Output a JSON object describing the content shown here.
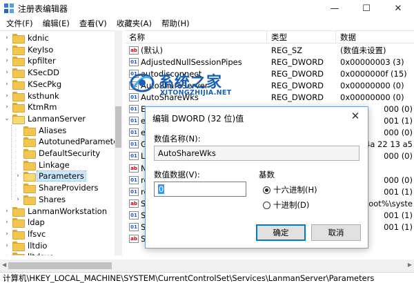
{
  "window": {
    "title": "注册表编辑器",
    "minimize": "—",
    "maximize": "☐",
    "close": "✕"
  },
  "menu": [
    "文件(F)",
    "编辑(E)",
    "查看(V)",
    "收藏夹(A)",
    "帮助(H)"
  ],
  "tree": {
    "items": [
      {
        "label": "kdnic",
        "expandable": true
      },
      {
        "label": "KeyIso",
        "expandable": true
      },
      {
        "label": "kpfilter",
        "expandable": true
      },
      {
        "label": "KSecDD",
        "expandable": true
      },
      {
        "label": "KSecPkg",
        "expandable": true
      },
      {
        "label": "ksthunk",
        "expandable": true
      },
      {
        "label": "KtmRm",
        "expandable": true
      },
      {
        "label": "LanmanServer",
        "expandable": true,
        "expanded": true
      },
      {
        "label": "Aliases",
        "child": true
      },
      {
        "label": "AutotunedParameters",
        "child": true
      },
      {
        "label": "DefaultSecurity",
        "child": true
      },
      {
        "label": "Linkage",
        "child": true
      },
      {
        "label": "Parameters",
        "child": true,
        "selected": true,
        "expandable": true
      },
      {
        "label": "ShareProviders",
        "child": true
      },
      {
        "label": "Shares",
        "child": true,
        "expandable": true
      },
      {
        "label": "LanmanWorkstation",
        "expandable": true
      },
      {
        "label": "ldap",
        "expandable": true
      },
      {
        "label": "lfsvc",
        "expandable": true
      },
      {
        "label": "lltdio",
        "expandable": true
      },
      {
        "label": "lltdsvc",
        "expandable": true
      }
    ]
  },
  "list": {
    "headers": [
      "名称",
      "类型",
      "数据"
    ],
    "rows": [
      {
        "icon": "ab",
        "name": "(默认)",
        "type": "REG_SZ",
        "data": "(数值未设置)"
      },
      {
        "icon": "bin",
        "name": "AdjustedNullSessionPipes",
        "type": "REG_DWORD",
        "data": "0x00000003 (3)"
      },
      {
        "icon": "bin",
        "name": "autodisconnect",
        "type": "REG_DWORD",
        "data": "0x0000000f (15)"
      },
      {
        "icon": "bin",
        "name": "AutoShareServer",
        "type": "REG_DWORD",
        "data": "0x00000000 (0)"
      },
      {
        "icon": "bin",
        "name": "AutoShareWks",
        "type": "REG_DWORD",
        "data": "0x00000000 (0)"
      },
      {
        "icon": "bin",
        "name": "En",
        "type": "",
        "data": "000 (0)"
      },
      {
        "icon": "bin",
        "name": "en",
        "type": "",
        "data": "001 (1)"
      },
      {
        "icon": "bin",
        "name": "en",
        "type": "",
        "data": "000 (0)"
      },
      {
        "icon": "bin",
        "name": "Gu",
        "type": "",
        "data": "4a 22 13 a5"
      },
      {
        "icon": "bin",
        "name": "Ln",
        "type": "",
        "data": "000 (0)"
      },
      {
        "icon": "ab",
        "name": "N",
        "type": "",
        "data": ""
      },
      {
        "icon": "bin",
        "name": "re",
        "type": "",
        "data": "000 (0)"
      },
      {
        "icon": "bin",
        "name": "re",
        "type": "",
        "data": "001 (1)"
      },
      {
        "icon": "ab",
        "name": "Se",
        "type": "",
        "data": "mRoot%\\syste"
      },
      {
        "icon": "bin",
        "name": "Se",
        "type": "",
        "data": "001 (1)"
      },
      {
        "icon": "bin",
        "name": "Si",
        "type": "",
        "data": "001 (1)"
      },
      {
        "icon": "ab",
        "name": "Sr",
        "type": "",
        "data": ""
      }
    ]
  },
  "watermark": {
    "text": "系统之家",
    "sub": "XITONGZHIJIA.NET"
  },
  "dialog": {
    "title": "编辑 DWORD (32 位)值",
    "close": "✕",
    "name_label": "数值名称(N):",
    "name_value": "AutoShareWks",
    "data_label": "数值数据(V):",
    "data_value": "0",
    "base_label": "基数",
    "hex_label": "十六进制(H)",
    "dec_label": "十进制(D)",
    "ok": "确定",
    "cancel": "取消"
  },
  "status": "计算机\\HKEY_LOCAL_MACHINE\\SYSTEM\\CurrentControlSet\\Services\\LanmanServer\\Parameters",
  "colors": {
    "selection": "#cce8ff",
    "accent": "#0078d7",
    "watermark": "#1a5fb4"
  }
}
